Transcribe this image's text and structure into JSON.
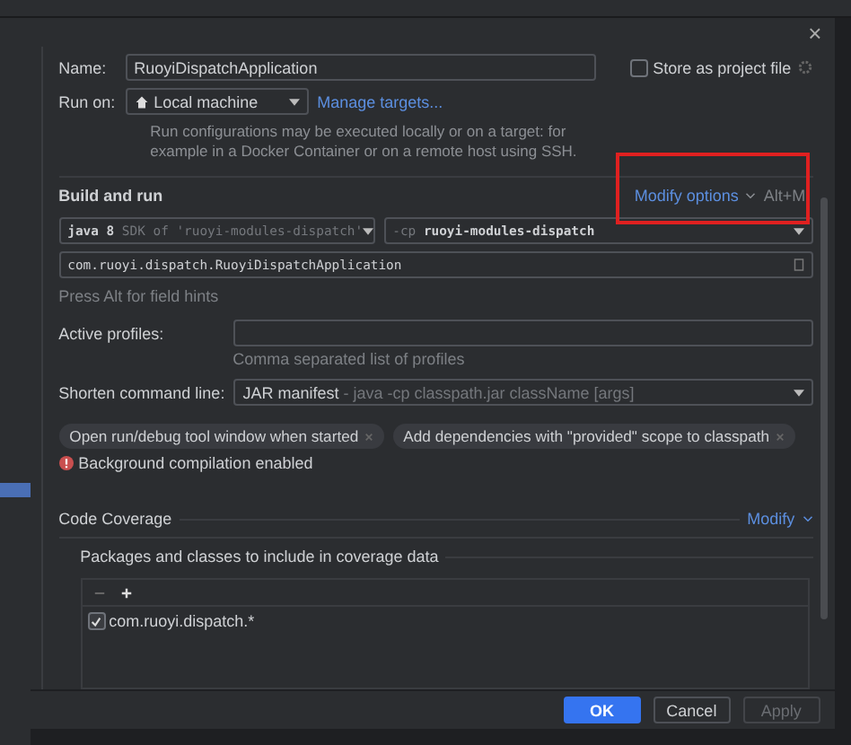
{
  "dialog": {
    "close": "×"
  },
  "name": {
    "label": "Name:",
    "value": "RuoyiDispatchApplication"
  },
  "store": {
    "label": "Store as project file",
    "checked": false
  },
  "run_on": {
    "label": "Run on:",
    "value": "Local machine",
    "link": "Manage targets...",
    "hint": "Run configurations may be executed locally or on a target: for example in a Docker Container or on a remote host using SSH."
  },
  "build": {
    "title": "Build and run",
    "modify": "Modify options",
    "shortcut": "Alt+M",
    "highlighted": true,
    "sdk": {
      "main": "java 8",
      "secondary": "SDK of 'ruoyi-modules-dispatch'"
    },
    "classpath": {
      "prefix": "-cp",
      "value": "ruoyi-modules-dispatch"
    },
    "main_class": "com.ruoyi.dispatch.RuoyiDispatchApplication",
    "hint": "Press Alt for field hints"
  },
  "profiles": {
    "label": "Active profiles:",
    "note": "Comma separated list of profiles"
  },
  "shorten": {
    "label": "Shorten command line:",
    "value": "JAR manifest",
    "detail": " - java -cp classpath.jar className [args]"
  },
  "chips": [
    {
      "label": "Open run/debug tool window when started"
    },
    {
      "label": "Add dependencies with \"provided\" scope to classpath"
    }
  ],
  "warning": "Background compilation enabled",
  "coverage": {
    "title": "Code Coverage",
    "modify": "Modify",
    "packages_label": "Packages and classes to include in coverage data",
    "items": [
      {
        "label": "com.ruoyi.dispatch.*",
        "checked": true
      }
    ]
  },
  "buttons": [
    {
      "label": "OK",
      "kind": "primary",
      "disabled": false
    },
    {
      "label": "Cancel",
      "kind": "normal",
      "disabled": false
    },
    {
      "label": "Apply",
      "kind": "normal",
      "disabled": true
    }
  ]
}
